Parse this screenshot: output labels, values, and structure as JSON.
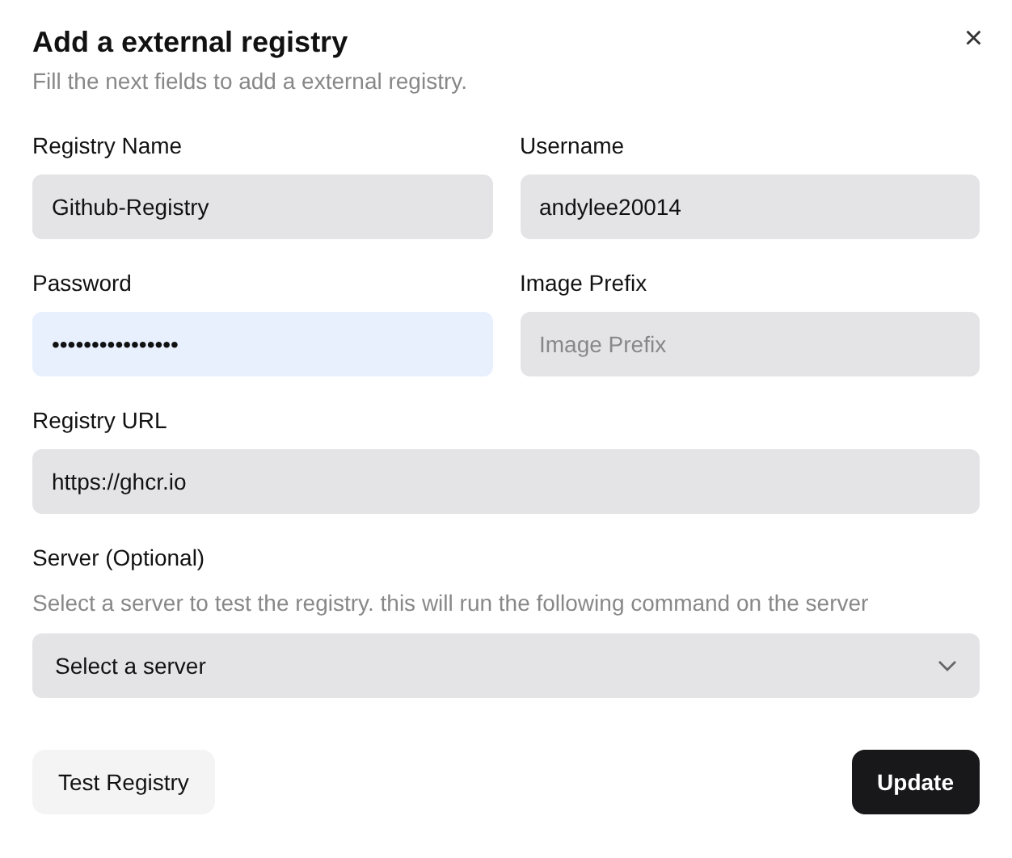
{
  "dialog": {
    "title": "Add a external registry",
    "description": "Fill the next fields to add a external registry.",
    "close_icon": "×"
  },
  "fields": [
    {
      "label": "Registry Name",
      "value": "Github-Registry",
      "focused": false,
      "kind": "half"
    },
    {
      "label": "Username",
      "value": "andylee20014",
      "focused": false,
      "kind": "half"
    },
    {
      "label": "Password",
      "value": "••••••••••••••••",
      "focused": true,
      "kind": "half"
    },
    {
      "label": "Image Prefix",
      "placeholder": "Image Prefix",
      "focused": false,
      "kind": "half"
    },
    {
      "label": "Registry URL",
      "value": "https://ghcr.io",
      "focused": false,
      "kind": "full"
    }
  ],
  "server": {
    "label": "Server (Optional)",
    "hint": "Select a server to test the registry. this will run the following command on the server",
    "placeholder": "Select a server"
  },
  "buttons": [
    {
      "label": "Test Registry",
      "kind": "secondary"
    },
    {
      "label": "Update",
      "kind": "primary"
    }
  ]
}
